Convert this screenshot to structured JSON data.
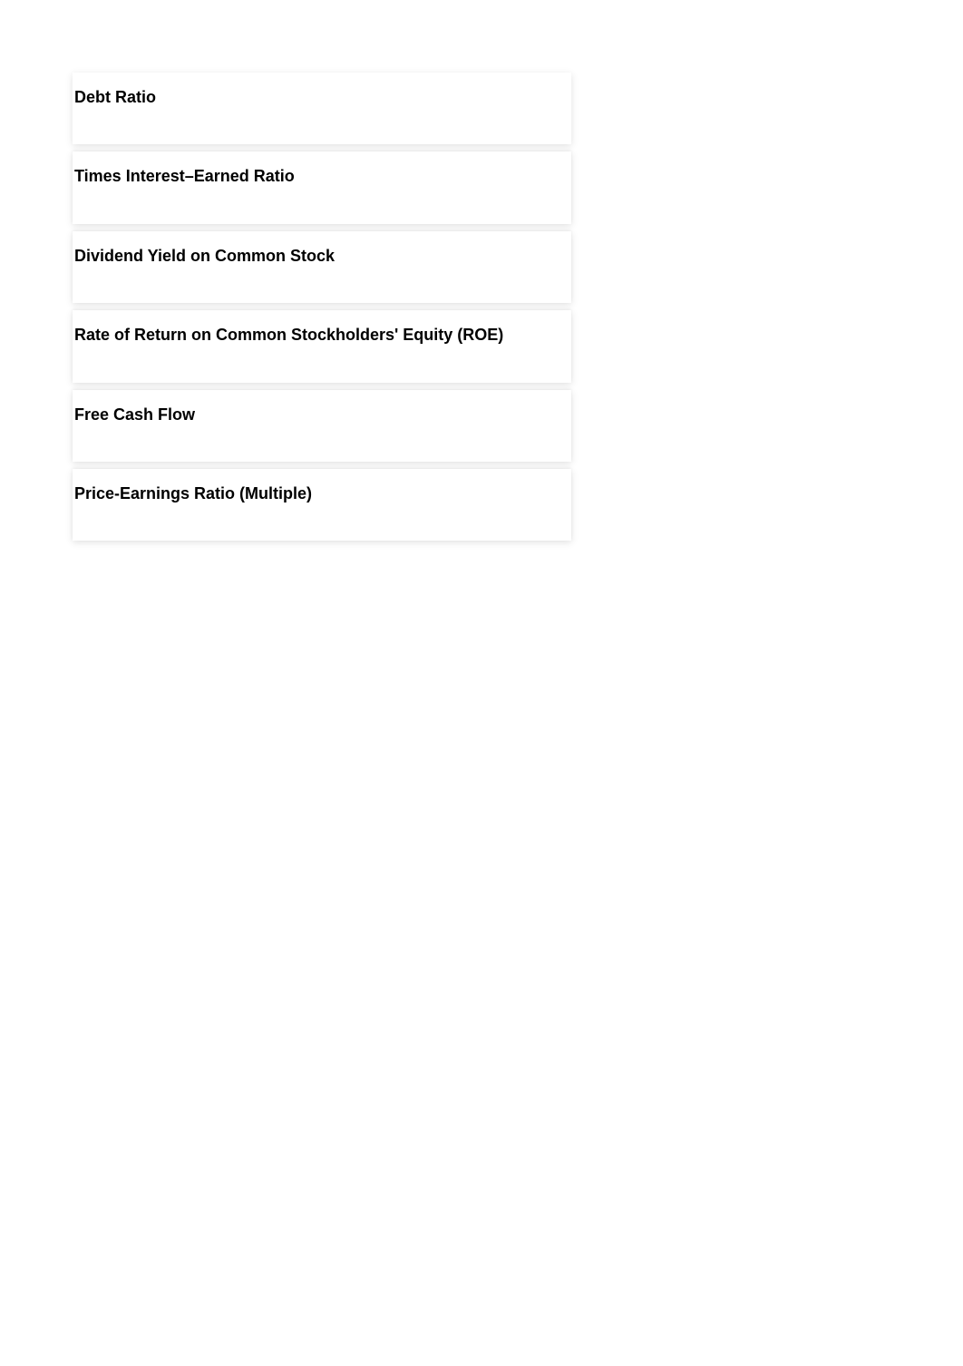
{
  "cards": [
    {
      "title": "Debt Ratio"
    },
    {
      "title": "Times Interest–Earned Ratio"
    },
    {
      "title": "Dividend Yield on Common Stock"
    },
    {
      "title": "Rate of Return on Common Stockholders' Equity (ROE)"
    },
    {
      "title": "Free Cash Flow"
    },
    {
      "title": "Price-Earnings Ratio (Multiple)"
    }
  ]
}
